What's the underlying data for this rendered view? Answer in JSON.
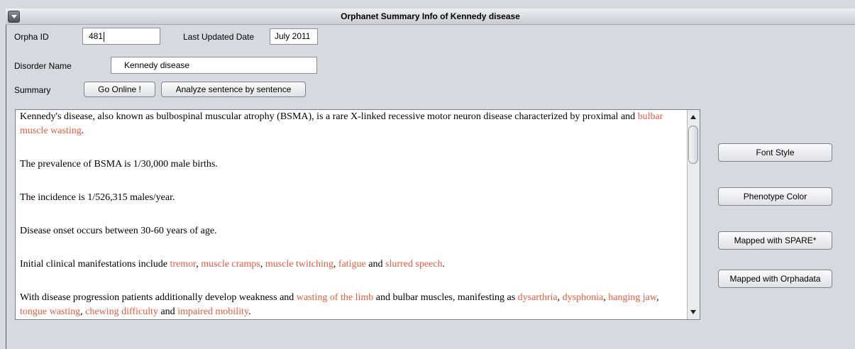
{
  "window": {
    "title": "Orphanet Summary Info of Kennedy disease"
  },
  "form": {
    "orpha_id_label": "Orpha ID",
    "orpha_id_value": "481",
    "last_updated_label": "Last Updated Date",
    "last_updated_value": "July 2011",
    "disorder_name_label": "Disorder Name",
    "disorder_name_value": "Kennedy disease",
    "summary_label": "Summary"
  },
  "buttons": {
    "go_online": "Go Online !",
    "analyze": "Analyze sentence by sentence",
    "font_style": "Font Style",
    "phenotype_color": "Phenotype Color",
    "mapped_spare": "Mapped with SPARE*",
    "mapped_orphadata": "Mapped with Orphadata"
  },
  "colors": {
    "phenotype_highlight": "#ee5a3d",
    "background": "#d6d9df"
  },
  "summary": {
    "p1_a": "Kennedy's disease, also known as bulbospinal muscular atrophy (BSMA), is a rare X-linked recessive motor neuron disease characterized by proximal and ",
    "p1_h1": "bulbar muscle wasting",
    "p1_b": ".",
    "p2": "The prevalence of BSMA is 1/30,000 male births.",
    "p3": "The incidence is 1/526,315 males/year.",
    "p4": "Disease onset occurs between 30-60 years of age.",
    "p5_a": "Initial clinical manifestations include ",
    "p5_h1": "tremor",
    "p5_s1": ", ",
    "p5_h2": "muscle cramps",
    "p5_s2": ", ",
    "p5_h3": "muscle twitching",
    "p5_s3": ", ",
    "p5_h4": "fatigue",
    "p5_s4": " and ",
    "p5_h5": "slurred speech",
    "p5_b": ".",
    "p6_a": "With disease progression patients additionally develop weakness and ",
    "p6_h1": "wasting of the limb",
    "p6_s1": " and bulbar muscles, manifesting as ",
    "p6_h2": "dysarthria",
    "p6_s2": ", ",
    "p6_h3": "dysphonia",
    "p6_s3": ", ",
    "p6_h4": "hanging jaw",
    "p6_s4": ", ",
    "p6_h5": "tongue wasting",
    "p6_s5": ", ",
    "p6_h6": "chewing difficulty",
    "p6_s6": " and ",
    "p6_h7": "impaired mobility",
    "p6_b": "."
  }
}
